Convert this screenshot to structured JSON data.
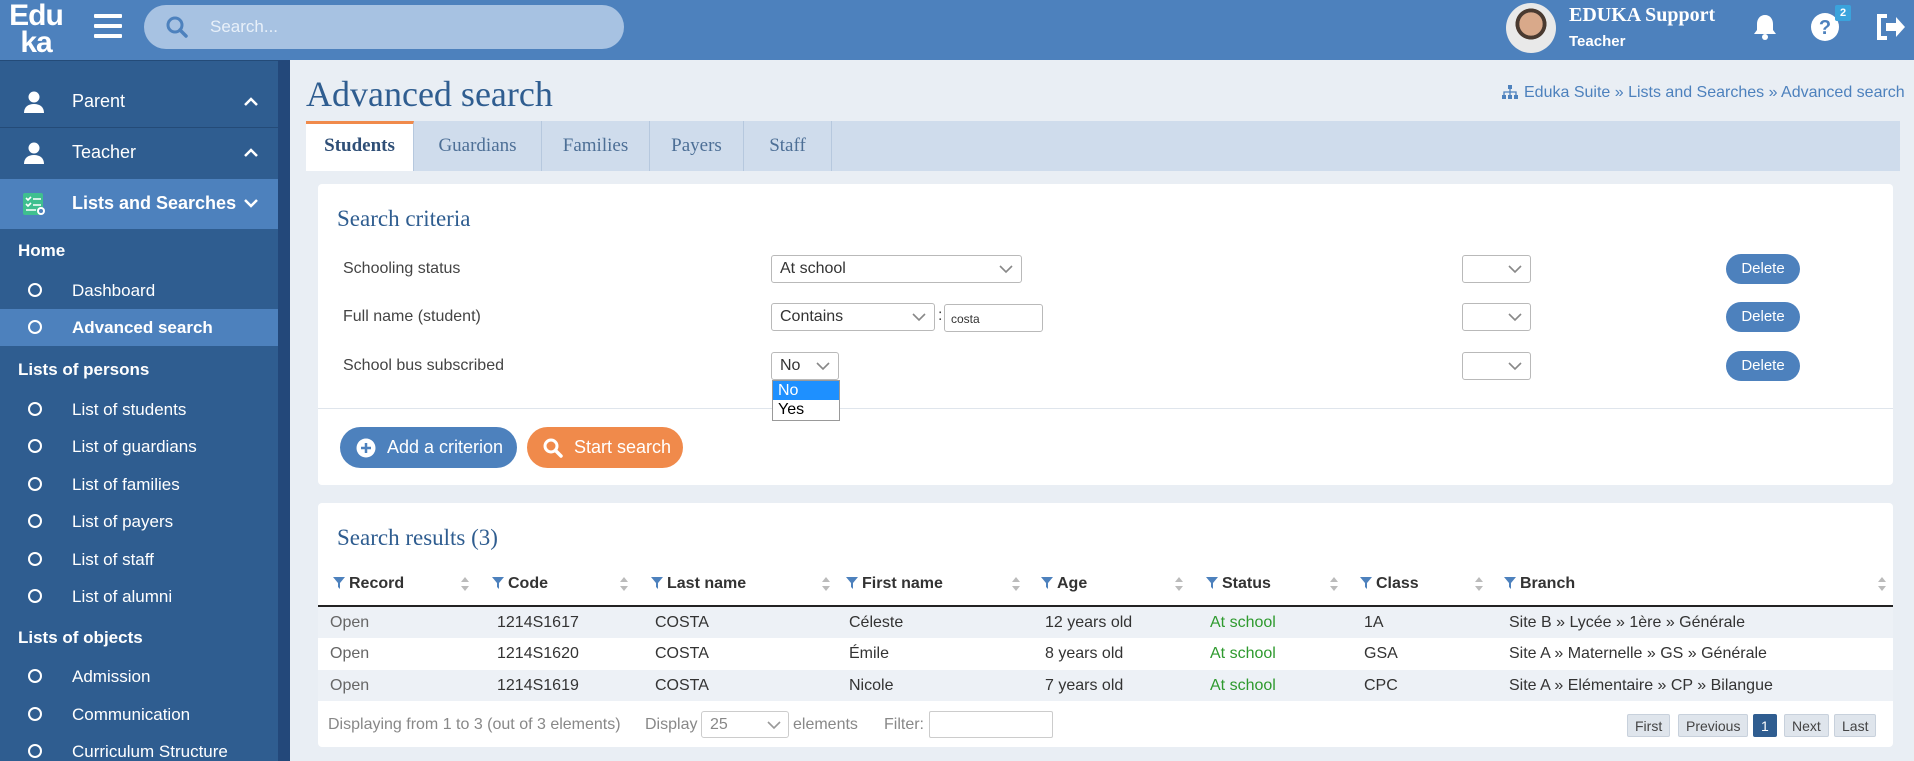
{
  "app": {
    "logo_line1": "Edu",
    "logo_line2": "ka",
    "search_placeholder": "Search...",
    "user_name": "EDUKA Support",
    "user_role": "Teacher",
    "help_badge": "2"
  },
  "sidebar": {
    "sections": [
      {
        "label": "Parent",
        "icon": "user-icon"
      },
      {
        "label": "Teacher",
        "icon": "user-icon"
      },
      {
        "label": "Lists and Searches",
        "icon": "checklist-icon"
      }
    ],
    "groups": {
      "home": "Home",
      "persons": "Lists of persons",
      "objects": "Lists of objects"
    },
    "home_items": [
      "Dashboard",
      "Advanced search"
    ],
    "person_items": [
      "List of students",
      "List of guardians",
      "List of families",
      "List of payers",
      "List of staff",
      "List of alumni"
    ],
    "object_items": [
      "Admission",
      "Communication",
      "Curriculum Structure"
    ]
  },
  "page": {
    "title": "Advanced search",
    "breadcrumb": "Eduka Suite » Lists and Searches » Advanced search"
  },
  "tabs": [
    "Students",
    "Guardians",
    "Families",
    "Payers",
    "Staff"
  ],
  "criteria": {
    "title": "Search criteria",
    "rows": [
      {
        "label": "Schooling status",
        "value": "At school"
      },
      {
        "label": "Full name (student)",
        "operator": "Contains",
        "value": "costa"
      },
      {
        "label": "School bus subscribed",
        "value": "No"
      }
    ],
    "delete_label": "Delete",
    "dropdown_options": [
      "No",
      "Yes"
    ],
    "add_label": "Add a criterion",
    "search_label": "Start search"
  },
  "results": {
    "title": "Search results (3)",
    "columns": [
      "Record",
      "Code",
      "Last name",
      "First name",
      "Age",
      "Status",
      "Class",
      "Branch"
    ],
    "rows": [
      [
        "Open",
        "1214S1617",
        "COSTA",
        "Céleste",
        "12 years old",
        "At school",
        "1A",
        "Site B » Lycée » 1ère » Générale"
      ],
      [
        "Open",
        "1214S1620",
        "COSTA",
        "Émile",
        "8 years old",
        "At school",
        "GSA",
        "Site A » Maternelle » GS » Générale"
      ],
      [
        "Open",
        "1214S1619",
        "COSTA",
        "Nicole",
        "7 years old",
        "At school",
        "CPC",
        "Site A » Elémentaire » CP » Bilangue"
      ]
    ],
    "footer": {
      "displaying": "Displaying from 1 to 3 (out of 3 elements)",
      "display_label": "Display",
      "page_size": "25",
      "elements_label": "elements",
      "filter_label": "Filter:",
      "first": "First",
      "previous": "Previous",
      "current_page": "1",
      "next": "Next",
      "last": "Last"
    }
  }
}
